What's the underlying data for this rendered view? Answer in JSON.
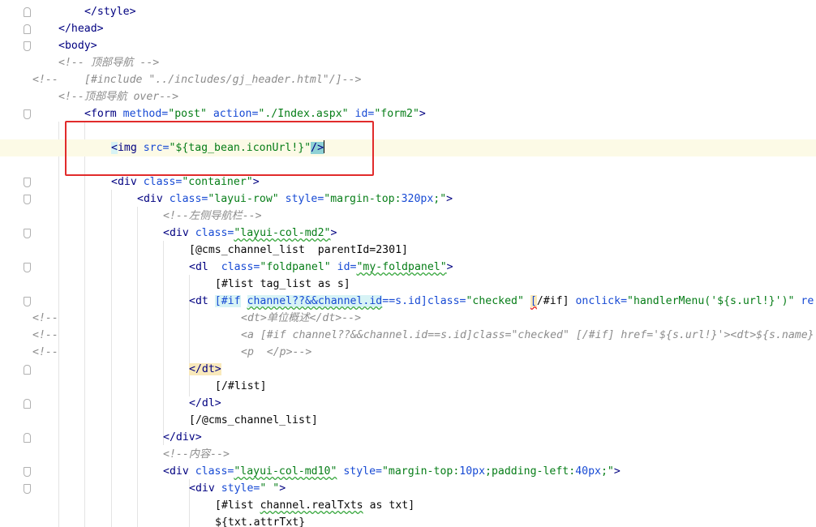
{
  "editor": {
    "language": "html",
    "colors": {
      "tag": "#000080",
      "attribute": "#174ad4",
      "string": "#067d17",
      "comment": "#8c8c8c",
      "caret_line": "#fcfae6",
      "highlight_box": "#e12b2b"
    },
    "gutter_comment_marker": "<!--",
    "lines": {
      "l1": {
        "t1": "</",
        "t2": "style",
        "t3": ">"
      },
      "l2": {
        "t1": "</",
        "t2": "head",
        "t3": ">"
      },
      "l3": {
        "t1": "<",
        "t2": "body",
        "t3": ">"
      },
      "l4": {
        "t1": "<!-- 顶部导航 -->"
      },
      "l5": {
        "t1": "[#include \"../includes/gj_header.html\"/]-->"
      },
      "l6": {
        "t1": "<!--顶部导航 over-->"
      },
      "l7": {
        "t1": "<",
        "t2": "form",
        "t3": " method=",
        "t4": "\"post\"",
        "t5": " action=",
        "t6": "\"./Index.aspx\"",
        "t7": " id=",
        "t8": "\"form2\"",
        "t9": ">"
      },
      "l8": {
        "t1": "<",
        "t2": "img",
        "t3": " src=",
        "t4": "\"${tag_bean.iconUrl!}\"",
        "t5": "/>"
      },
      "l9": {
        "t1": "<",
        "t2": "div",
        "t3": " class=",
        "t4": "\"container\"",
        "t5": ">"
      },
      "l10": {
        "t1": "<",
        "t2": "div",
        "t3": " class=",
        "t4": "\"layui-row\"",
        "t5": " style=",
        "t6": "\"margin-top:",
        "t7": "320px",
        "t8": ";\"",
        "t9": ">"
      },
      "l11": {
        "t1": "<!--左侧导航栏-->"
      },
      "l12": {
        "t1": "<",
        "t2": "div",
        "t3": " class=",
        "t4": "\"layui-col-md2\"",
        "t5": ">"
      },
      "l13": {
        "t1": "[@cms_channel_list  parentId=2301]"
      },
      "l14": {
        "t1": "<",
        "t2": "dl",
        "t3": "  class=",
        "t4": "\"foldpanel\"",
        "t5": " id=",
        "t6": "\"my-foldpanel\"",
        "t7": ">"
      },
      "l15": {
        "t1": "[#list tag_list as s]"
      },
      "l16": {
        "t1": "<",
        "t2": "dt",
        "t3": " ",
        "t4": "[#if",
        "t5": " ",
        "t6": "channel??&&channel.id",
        "t7": "==s.id]class=",
        "t8": "\"checked\"",
        "t9": " ",
        "t10": "[",
        "t11": "/#if]",
        "t12": " onclick=",
        "t13": "\"handlerMenu('${s.url!}')\"",
        "t14": " re"
      },
      "l17": {
        "t1": "<dt>单位概述</dt>-->"
      },
      "l18": {
        "t1": "<a [#if channel??&&channel.id==s.id]class=\"checked\" [/#if] href='${s.url!}'><dt>${s.name}"
      },
      "l19": {
        "t1": "<p  </p>-->"
      },
      "l20": {
        "t1": "</dt",
        "t2": ">"
      },
      "l21": {
        "t1": "[/#list]"
      },
      "l22": {
        "t1": "</",
        "t2": "dl",
        "t3": ">"
      },
      "l23": {
        "t1": "[/@cms_channel_list]"
      },
      "l24": {
        "t1": "</",
        "t2": "div",
        "t3": ">"
      },
      "l25": {
        "t1": "<!--内容-->"
      },
      "l26": {
        "t1": "<",
        "t2": "div",
        "t3": " class=",
        "t4": "\"layui-col-md10\"",
        "t5": " style=",
        "t6": "\"margin-top:",
        "t7": "10px",
        "t8": ";padding-left:",
        "t9": "40px",
        "t10": ";\"",
        "t11": ">"
      },
      "l27": {
        "t1": "<",
        "t2": "div",
        "t3": " style=",
        "t4": "\" \"",
        "t5": ">"
      },
      "l28": {
        "t1": "[#list ",
        "t2": "channel.realTxts",
        "t3": " as txt]"
      },
      "l29": {
        "t1": "${txt.attrTxt}"
      }
    }
  }
}
